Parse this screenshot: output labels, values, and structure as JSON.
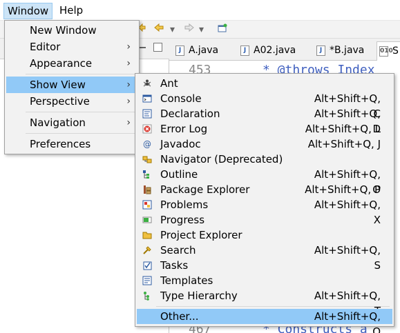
{
  "menubar": {
    "window_label": "Window",
    "help_label": "Help"
  },
  "editor_tabs": [
    {
      "label": "A.java"
    },
    {
      "label": "A02.java"
    },
    {
      "label": "*B.java"
    },
    {
      "label": "S"
    }
  ],
  "editor_lines": [
    {
      "num": "453",
      "text": "* @throws  Index"
    },
    {
      "num": "467",
      "text": "* Constructs a"
    }
  ],
  "window_menu": {
    "items": [
      {
        "label": "New Window"
      },
      {
        "label": "Editor",
        "arrow": "›"
      },
      {
        "label": "Appearance",
        "arrow": "›"
      },
      {
        "label": "Show View",
        "arrow": "›"
      },
      {
        "label": "Perspective",
        "arrow": "›"
      },
      {
        "label": "Navigation",
        "arrow": "›"
      },
      {
        "label": "Preferences"
      }
    ]
  },
  "show_view_menu": {
    "items": [
      {
        "label": "Ant",
        "shortcut": "",
        "icon": "ant-icon"
      },
      {
        "label": "Console",
        "shortcut": "Alt+Shift+Q, C",
        "icon": "console-icon"
      },
      {
        "label": "Declaration",
        "shortcut": "Alt+Shift+Q, D",
        "icon": "declaration-icon"
      },
      {
        "label": "Error Log",
        "shortcut": "Alt+Shift+Q, L",
        "icon": "error-log-icon"
      },
      {
        "label": "Javadoc",
        "shortcut": "Alt+Shift+Q, J",
        "icon": "javadoc-icon"
      },
      {
        "label": "Navigator (Deprecated)",
        "shortcut": "",
        "icon": "navigator-icon"
      },
      {
        "label": "Outline",
        "shortcut": "Alt+Shift+Q, O",
        "icon": "outline-icon"
      },
      {
        "label": "Package Explorer",
        "shortcut": "Alt+Shift+Q, P",
        "icon": "package-explorer-icon"
      },
      {
        "label": "Problems",
        "shortcut": "Alt+Shift+Q, X",
        "icon": "problems-icon"
      },
      {
        "label": "Progress",
        "shortcut": "",
        "icon": "progress-icon"
      },
      {
        "label": "Project Explorer",
        "shortcut": "",
        "icon": "project-explorer-icon"
      },
      {
        "label": "Search",
        "shortcut": "Alt+Shift+Q, S",
        "icon": "search-icon"
      },
      {
        "label": "Tasks",
        "shortcut": "",
        "icon": "tasks-icon"
      },
      {
        "label": "Templates",
        "shortcut": "",
        "icon": "templates-icon"
      },
      {
        "label": "Type Hierarchy",
        "shortcut": "Alt+Shift+Q, T",
        "icon": "type-hierarchy-icon"
      },
      {
        "label": "Other...",
        "shortcut": "Alt+Shift+Q, Q",
        "icon": ""
      }
    ]
  },
  "colors": {
    "highlight": "#91c9f7",
    "menu_bg": "#f2f2f2",
    "menubar_active": "#cce4f7"
  }
}
